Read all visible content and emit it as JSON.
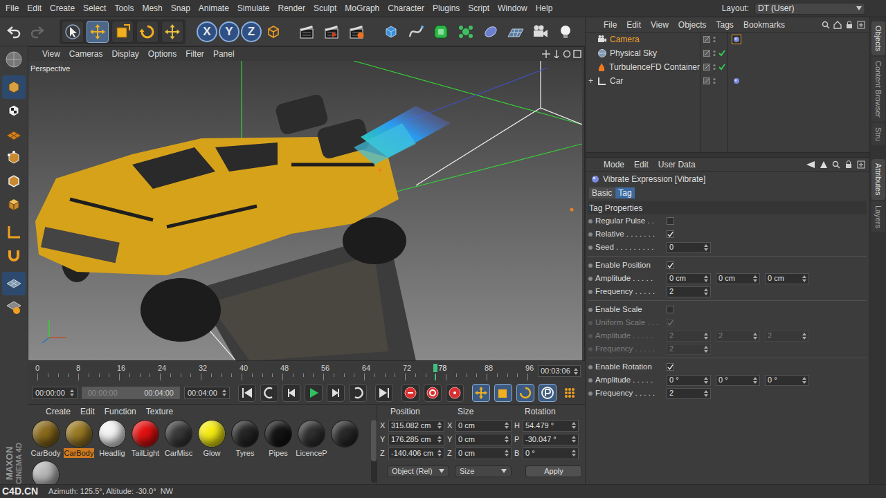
{
  "menubar": {
    "items": [
      "File",
      "Edit",
      "Create",
      "Select",
      "Tools",
      "Mesh",
      "Snap",
      "Animate",
      "Simulate",
      "Render",
      "Sculpt",
      "MoGraph",
      "Character",
      "Plugins",
      "Script",
      "Window",
      "Help"
    ],
    "layout_label": "Layout:",
    "layout_value": "DT (User)"
  },
  "toolbar": {
    "tools": [
      {
        "selected": false
      },
      {
        "selected": true
      },
      {
        "selected": false
      },
      {
        "selected": false
      },
      {
        "selected": false
      }
    ],
    "axes": [
      {
        "label": "X",
        "on": true
      },
      {
        "label": "Y",
        "on": true
      },
      {
        "label": "Z",
        "on": true
      }
    ]
  },
  "viewport": {
    "menu": [
      "View",
      "Cameras",
      "Display",
      "Options",
      "Filter",
      "Panel"
    ],
    "camera": "Perspective"
  },
  "timeline": {
    "ticks": [
      "0",
      "8",
      "16",
      "24",
      "32",
      "40",
      "48",
      "56",
      "64",
      "72",
      "88",
      "96"
    ],
    "current": "78",
    "level": 0.8125,
    "time": "00:03:06"
  },
  "transport": {
    "start": "00:00:00",
    "range_start": "00:00:00",
    "range_end": "00:04:00",
    "end": "00:04:00",
    "range_level": 1
  },
  "materials": {
    "menu": [
      "Create",
      "Edit",
      "Function",
      "Texture"
    ],
    "items": [
      {
        "name": "CarBody",
        "selected": false,
        "color": "#8a6a1c"
      },
      {
        "name": "CarBody",
        "selected": true,
        "color": "#9a7a24"
      },
      {
        "name": "Headlig",
        "selected": false,
        "color": "#f4f4f4"
      },
      {
        "name": "TailLight",
        "selected": false,
        "color": "#e31010"
      },
      {
        "name": "CarMisc",
        "selected": false,
        "color": "#3a3a3a"
      },
      {
        "name": "Glow",
        "selected": false,
        "color": "#f6ec12"
      },
      {
        "name": "Tyres",
        "selected": false,
        "color": "#262626"
      },
      {
        "name": "Pipes",
        "selected": false,
        "color": "#141414"
      },
      {
        "name": "LicenceP",
        "selected": false,
        "color": "#303030"
      },
      {
        "selected": false,
        "color": "#2a2a2a"
      },
      {
        "selected": false,
        "color": "#b8b8b8"
      }
    ]
  },
  "coordinates": {
    "headers": [
      "Position",
      "Size",
      "Rotation"
    ],
    "rows": [
      [
        {
          "axis": "X",
          "value": "315.082 cm"
        },
        {
          "axis": "X",
          "value": "0 cm"
        },
        {
          "axis": "H",
          "value": "54.479 °"
        }
      ],
      [
        {
          "axis": "Y",
          "value": "176.285 cm"
        },
        {
          "axis": "Y",
          "value": "0 cm"
        },
        {
          "axis": "P",
          "value": "-30.047 °"
        }
      ],
      [
        {
          "axis": "Z",
          "value": "-140.406 cm"
        },
        {
          "axis": "Z",
          "value": "0 cm"
        },
        {
          "axis": "B",
          "value": "0 °"
        }
      ]
    ],
    "mode": "Object (Rel)",
    "size_mode": "Size",
    "apply": "Apply"
  },
  "objects": {
    "menu": [
      "File",
      "Edit",
      "View",
      "Objects",
      "Tags",
      "Bookmarks"
    ],
    "items": [
      {
        "name": "Camera",
        "selected": true,
        "check": false,
        "tag": true,
        "tag_selected": true
      },
      {
        "name": "Physical Sky",
        "selected": false,
        "check": true,
        "tag": false,
        "tag_selected": false
      },
      {
        "name": "TurbulenceFD Container",
        "selected": false,
        "check": true,
        "tag": false,
        "tag_selected": false
      },
      {
        "name": "Car",
        "selected": false,
        "check": false,
        "tag": true,
        "tag_selected": false,
        "toggle": "+"
      }
    ]
  },
  "attributes": {
    "menu": [
      "Mode",
      "Edit",
      "User Data"
    ],
    "title": "Vibrate Expression [Vibrate]",
    "tabs": [
      {
        "label": "Basic",
        "selected": false
      },
      {
        "label": "Tag",
        "selected": true
      }
    ],
    "section": "Tag Properties",
    "rows": [
      {
        "kind": "checkbox",
        "label": "Regular Pulse . .",
        "checked": false,
        "disabled": false,
        "divider_before": false
      },
      {
        "kind": "checkbox",
        "label": "Relative . . . . . . .",
        "checked": true,
        "disabled": false,
        "divider_before": false
      },
      {
        "kind": "number",
        "label": "Seed . . . . . . . . .",
        "values": [
          "0"
        ],
        "disabled": false,
        "divider_before": false
      },
      {
        "kind": "checkbox",
        "label": "Enable Position",
        "checked": true,
        "disabled": false,
        "divider_before": true
      },
      {
        "kind": "vector",
        "label": "Amplitude . . . . .",
        "values": [
          "0 cm",
          "0 cm",
          "0 cm"
        ],
        "disabled": false,
        "divider_before": false
      },
      {
        "kind": "number",
        "label": "Frequency . . . . .",
        "values": [
          "2"
        ],
        "disabled": false,
        "divider_before": false
      },
      {
        "kind": "checkbox",
        "label": "Enable Scale",
        "checked": false,
        "disabled": false,
        "divider_before": true
      },
      {
        "kind": "checkbox",
        "label": "Uniform Scale . . .",
        "checked": true,
        "disabled": true,
        "divider_before": false
      },
      {
        "kind": "vector",
        "label": "Amplitude . . . . .",
        "values": [
          "2",
          "2",
          "2"
        ],
        "disabled": true,
        "divider_before": false
      },
      {
        "kind": "number",
        "label": "Frequency . . . . .",
        "values": [
          "2"
        ],
        "disabled": true,
        "divider_before": false
      },
      {
        "kind": "checkbox",
        "label": "Enable Rotation",
        "checked": true,
        "disabled": false,
        "divider_before": true
      },
      {
        "kind": "vector",
        "label": "Amplitude . . . . .",
        "values": [
          "0 °",
          "0 °",
          "0 °"
        ],
        "disabled": false,
        "divider_before": false
      },
      {
        "kind": "number",
        "label": "Frequency . . . . .",
        "values": [
          "2"
        ],
        "disabled": false,
        "divider_before": false
      }
    ]
  },
  "side_tabs": [
    {
      "label": "Objects",
      "selected": true
    },
    {
      "label": "Content Browser",
      "selected": false
    },
    {
      "label": "Stru",
      "selected": false
    },
    {
      "label": "Attributes",
      "selected": true
    },
    {
      "label": "Layers",
      "selected": false
    }
  ],
  "logo": [
    "MAXON",
    "CINEMA 4D"
  ],
  "watermark": "C4D.CN",
  "status_bar": "Azimuth: 125.5°, Altitude: -30.0°  NW"
}
